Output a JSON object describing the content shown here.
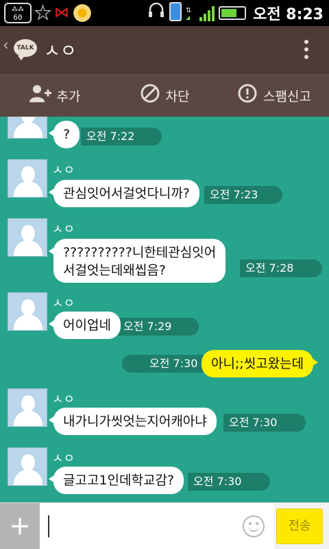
{
  "status_bar": {
    "badge_text": "60",
    "icons": [
      "notification-badge-icon",
      "star-icon",
      "bow-icon",
      "flower-icon",
      "headset-icon",
      "phone-icon",
      "wifi-icon",
      "signal-icon",
      "battery-icon"
    ],
    "time": "오전 8:23",
    "battery_level": 0.6
  },
  "header": {
    "back_symbol": "‹",
    "logo_text": "TALK",
    "title": "ㅅㅇ"
  },
  "actions": [
    {
      "label": "추가",
      "icon": "add-friend-icon"
    },
    {
      "label": "차단",
      "icon": "block-icon"
    },
    {
      "label": "스팸신고",
      "icon": "report-icon"
    }
  ],
  "messages": [
    {
      "sender": "",
      "text": "?",
      "time": "오전 7:22",
      "mine": false
    },
    {
      "sender": "ㅅㅇ",
      "text": "관심잇어서걸엇다니까?",
      "time": "오전 7:23",
      "mine": false
    },
    {
      "sender": "ㅅㅇ",
      "text": "??????????니한테관심잇어",
      "text2": "서걸엇는데왜씹음?",
      "time": "오전 7:28",
      "mine": false
    },
    {
      "sender": "ㅅㅇ",
      "text": "어이업네",
      "time": "오전 7:29",
      "mine": false
    },
    {
      "sender": "",
      "text": "아니;;씻고왔는데",
      "time": "오전 7:30",
      "mine": true
    },
    {
      "sender": "ㅅㅇ",
      "text": "내가니가씻엇는지어캐아냐",
      "time": "오전 7:30",
      "mine": false
    },
    {
      "sender": "ㅅㅇ",
      "text": "글고고1인데학교감?",
      "time": "오전 7:30",
      "mine": false
    }
  ],
  "input": {
    "value": "",
    "send_label": "전송",
    "plus_symbol": "+"
  },
  "colors": {
    "chat_bg": "#27a58c",
    "header_bg": "#4e3a36",
    "my_bubble": "#fff200",
    "send_button": "#ffe800"
  }
}
